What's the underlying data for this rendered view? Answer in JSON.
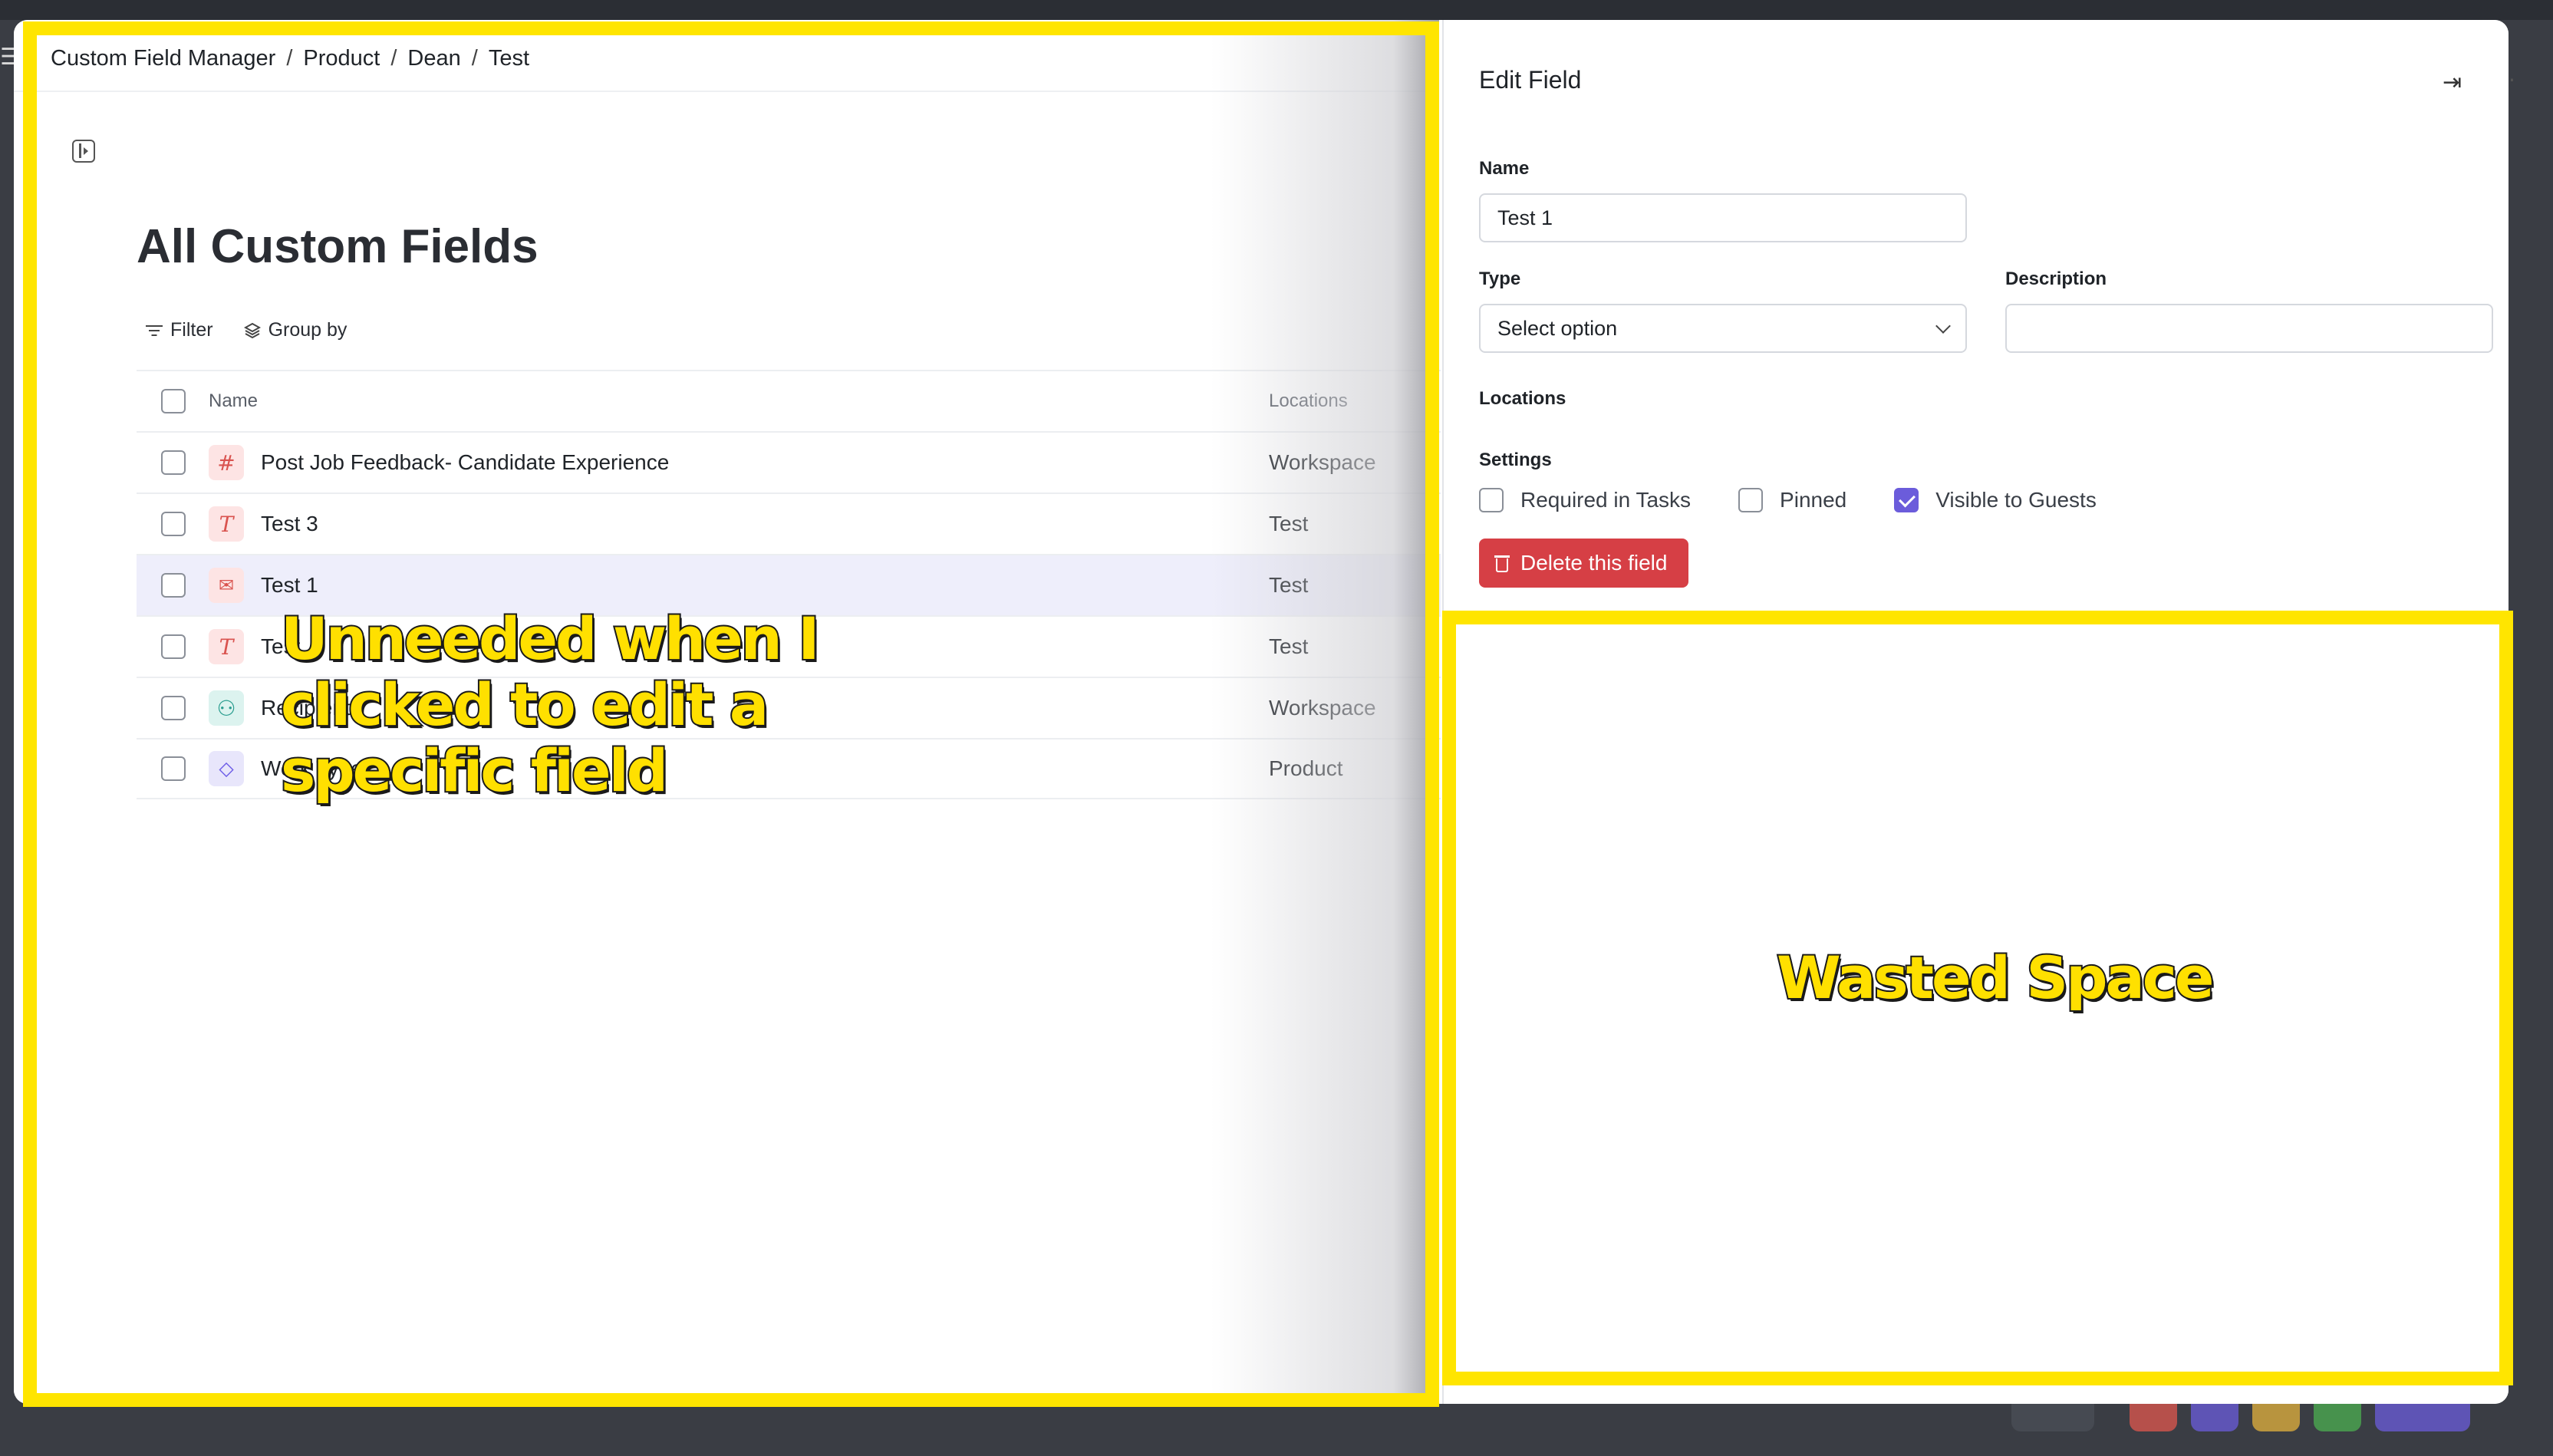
{
  "breadcrumb": {
    "items": [
      "Custom Field Manager",
      "Product",
      "Dean",
      "Test"
    ],
    "separator": "/"
  },
  "list": {
    "title": "All Custom Fields",
    "toolbar": {
      "filter_label": "Filter",
      "group_by_label": "Group by"
    },
    "columns": {
      "name": "Name",
      "locations": "Locations"
    },
    "rows": [
      {
        "name": "Post Job Feedback- Candidate Experience",
        "location": "Workspace",
        "icon": "hash-icon",
        "glyph": "#"
      },
      {
        "name": "Test 3",
        "location": "Test",
        "icon": "text-icon",
        "glyph": "T"
      },
      {
        "name": "Test 1",
        "location": "Test",
        "icon": "email-icon",
        "glyph": "✉"
      },
      {
        "name": "Test",
        "location": "Test",
        "icon": "text-icon",
        "glyph": "T"
      },
      {
        "name": "Recipient",
        "location": "Workspace",
        "icon": "person-icon",
        "glyph": "⚇"
      },
      {
        "name": "Work Type",
        "location": "Product",
        "icon": "tag-icon",
        "glyph": "⬦"
      }
    ]
  },
  "edit_field": {
    "title": "Edit Field",
    "name_label": "Name",
    "name_value": "Test 1",
    "type_label": "Type",
    "type_value": "Select option",
    "description_label": "Description",
    "description_value": "",
    "locations_label": "Locations",
    "settings_label": "Settings",
    "settings": [
      {
        "label": "Required in Tasks",
        "checked": false
      },
      {
        "label": "Pinned",
        "checked": false
      },
      {
        "label": "Visible to Guests",
        "checked": true
      }
    ],
    "delete_label": "Delete this field"
  },
  "annotations": {
    "left": "Unneeded when I\nclicked to edit a\nspecific field",
    "right": "Wasted Space",
    "color": "#ffe500"
  },
  "colors": {
    "accent": "#6b5cdb",
    "danger": "#d63f45",
    "selected_row": "#eeeefb"
  }
}
